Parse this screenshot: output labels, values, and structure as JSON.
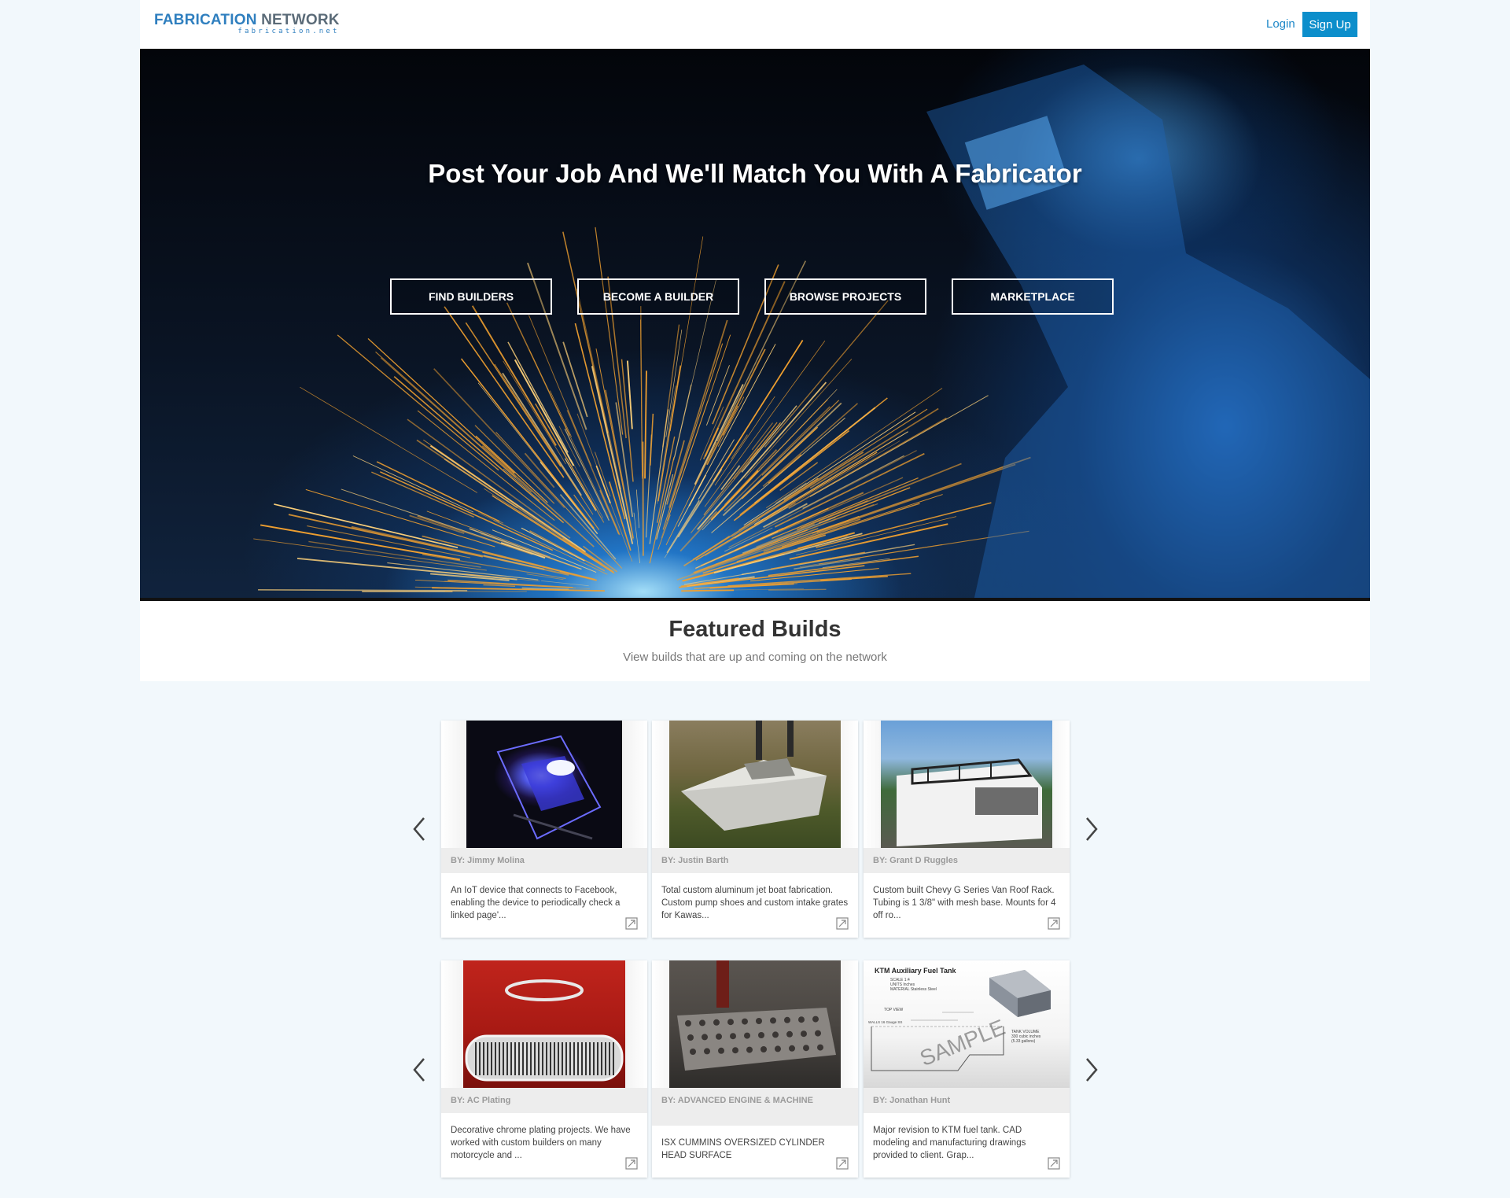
{
  "header": {
    "logo_main_a": "FABRICATION",
    "logo_main_b": "NETWORK",
    "logo_sub": "fabrication.net",
    "login": "Login",
    "signup": "Sign Up"
  },
  "hero": {
    "title": "Post Your Job And We'll Match You With A Fabricator",
    "buttons": [
      "FIND BUILDERS",
      "BECOME A BUILDER",
      "BROWSE PROJECTS",
      "MARKETPLACE"
    ]
  },
  "featured": {
    "title": "Featured Builds",
    "subtitle": "View builds that are up and coming on the network"
  },
  "cards": [
    {
      "author": "BY: Jimmy Molina",
      "desc": "An IoT device that connects to Facebook, enabling the device to periodically check a linked page'..."
    },
    {
      "author": "BY: Justin Barth",
      "desc": "Total custom aluminum jet boat fabrication. Custom pump shoes and custom intake grates for Kawas..."
    },
    {
      "author": "BY: Grant D Ruggles",
      "desc": "Custom built Chevy G Series Van Roof Rack. Tubing is 1 3/8\" with mesh base. Mounts for 4 off ro..."
    },
    {
      "author": "BY: AC Plating",
      "desc": "Decorative chrome plating projects. We have worked with custom builders on many motorcycle and ..."
    },
    {
      "author": "BY: ADVANCED ENGINE & MACHINE",
      "desc": "ISX CUMMINS OVERSIZED CYLINDER HEAD SURFACE"
    },
    {
      "author": "BY: Jonathan Hunt",
      "desc": "Major revision to KTM fuel tank. CAD modeling and manufacturing drawings provided to client. Grap..."
    }
  ],
  "drawing": {
    "title": "KTM Auxiliary Fuel Tank",
    "meta": [
      "SCALE 1:4",
      "UNITS Inches",
      "MATERIAL Stainless Steel"
    ],
    "top_view": "TOP VIEW",
    "walls": "WALLS 16 Gauge SS",
    "tank_volume": [
      "TANK VOLUME",
      "330 cubic inches",
      "(5.33 gallons)"
    ],
    "watermark": "SAMPLE"
  },
  "icons": {
    "prev": "chevron-left-icon",
    "next": "chevron-right-icon",
    "expand": "expand-icon"
  }
}
